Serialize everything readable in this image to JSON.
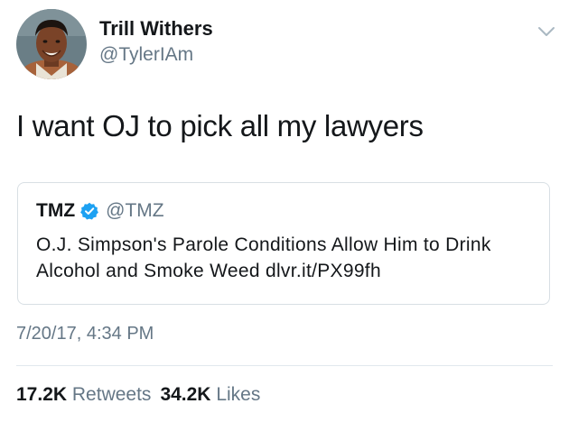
{
  "author": {
    "display_name": "Trill Withers",
    "handle": "@TylerIAm",
    "avatar_icon": "profile-photo"
  },
  "menu": {
    "icon": "chevron-down-icon"
  },
  "tweet": {
    "text": "I want OJ to pick all my lawyers",
    "timestamp": "7/20/17, 4:34 PM"
  },
  "quoted_tweet": {
    "name": "TMZ",
    "verified_icon": "verified-badge-icon",
    "handle": "@TMZ",
    "text": "O.J. Simpson's Parole Conditions Allow Him to Drink Alcohol and Smoke Weed dlvr.it/PX99fh"
  },
  "stats": {
    "retweets_count": "17.2K",
    "retweets_label": "Retweets",
    "likes_count": "34.2K",
    "likes_label": "Likes"
  },
  "colors": {
    "primary_text": "#14171a",
    "secondary_text": "#657786",
    "verified_blue": "#1da1f2",
    "border": "#d8dfe4"
  }
}
